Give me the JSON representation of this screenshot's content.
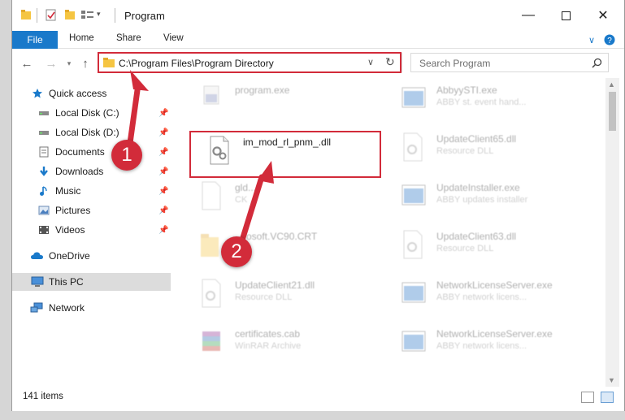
{
  "window": {
    "title": "Program"
  },
  "ribbon": {
    "file": "File",
    "tabs": [
      "Home",
      "Share",
      "View"
    ]
  },
  "address": {
    "path": "C:\\Program Files\\Program Directory",
    "search_placeholder": "Search Program"
  },
  "nav": {
    "items": [
      {
        "label": "Quick access",
        "icon": "star-icon",
        "pinned": false
      },
      {
        "label": "Local Disk (C:)",
        "icon": "drive-icon",
        "pinned": true
      },
      {
        "label": "Local Disk (D:)",
        "icon": "drive-icon",
        "pinned": true
      },
      {
        "label": "Documents",
        "icon": "documents-icon",
        "pinned": true
      },
      {
        "label": "Downloads",
        "icon": "download-icon",
        "pinned": true
      },
      {
        "label": "Music",
        "icon": "music-icon",
        "pinned": true
      },
      {
        "label": "Pictures",
        "icon": "pictures-icon",
        "pinned": true
      },
      {
        "label": "Videos",
        "icon": "videos-icon",
        "pinned": true
      },
      {
        "label": "OneDrive",
        "icon": "cloud-icon",
        "pinned": false
      },
      {
        "label": "This PC",
        "icon": "computer-icon",
        "pinned": false,
        "selected": true
      },
      {
        "label": "Network",
        "icon": "network-icon",
        "pinned": false
      }
    ]
  },
  "files": [
    {
      "name": "program.exe",
      "desc": "",
      "faded": true
    },
    {
      "name": "AbbyySTI.exe",
      "desc": "ABBY st. event hand...",
      "faded": true
    },
    {
      "name": "im_mod_rl_pnm_.dll",
      "desc": "",
      "faded": false
    },
    {
      "name": "UpdateClient65.dll",
      "desc": "Resource DLL",
      "faded": true
    },
    {
      "name": "gld...",
      "desc": "CK ...",
      "faded": true
    },
    {
      "name": "UpdateInstaller.exe",
      "desc": "ABBY updates installer",
      "faded": true
    },
    {
      "name": "...rosoft.VC90.CRT",
      "desc": "",
      "faded": true
    },
    {
      "name": "UpdateClient63.dll",
      "desc": "Resource DLL",
      "faded": true
    },
    {
      "name": "UpdateClient21.dll",
      "desc": "Resource DLL",
      "faded": true
    },
    {
      "name": "NetworkLicenseServer.exe",
      "desc": "ABBY network licens...",
      "faded": true
    },
    {
      "name": "certificates.cab",
      "desc": "WinRAR Archive",
      "faded": true
    },
    {
      "name": "NetworkLicenseServer.exe",
      "desc": "ABBY network licens...",
      "faded": true
    }
  ],
  "status": {
    "items": "141 items"
  },
  "annotations": {
    "step1": "1",
    "step2": "2"
  },
  "colors": {
    "accent": "#1979ca",
    "annotation": "#d22b3a"
  }
}
